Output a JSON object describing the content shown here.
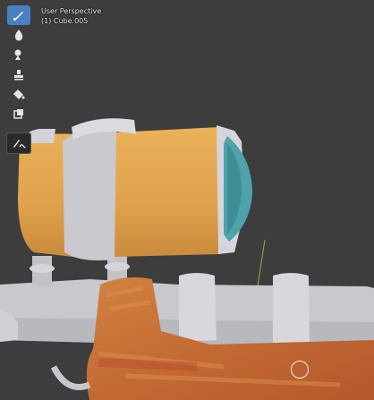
{
  "viewport": {
    "view_name": "User Perspective",
    "object_label": "(1) Cube.005"
  },
  "toolbar": {
    "tools": [
      {
        "name": "draw-tool",
        "icon": "brush-icon",
        "active": true
      },
      {
        "name": "blur-tool",
        "icon": "drop-icon",
        "active": false
      },
      {
        "name": "smear-tool",
        "icon": "smear-icon",
        "active": false
      },
      {
        "name": "clone-tool",
        "icon": "stamp-icon",
        "active": false
      },
      {
        "name": "fill-tool",
        "icon": "bucket-icon",
        "active": false
      },
      {
        "name": "mask-tool",
        "icon": "mask-icon",
        "active": false
      },
      {
        "name": "annotate-tool",
        "icon": "annotate-icon",
        "active": false
      }
    ]
  },
  "colors": {
    "viewport_bg": "#3d3d3d",
    "accent": "#4a7fc1",
    "scope_orange": "#e3a44f",
    "lens_teal": "#4fa3aa",
    "metal_white": "#c9c9cf",
    "wood_base": "#c8763a"
  }
}
